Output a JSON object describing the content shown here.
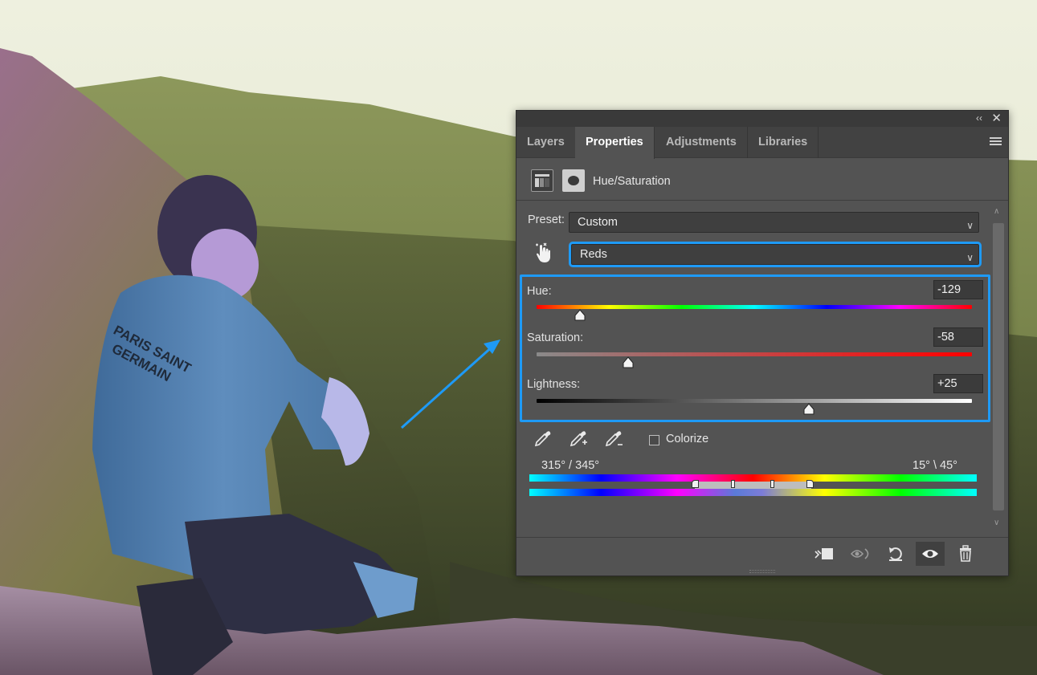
{
  "panel": {
    "tabs": [
      {
        "label": "Layers",
        "active": false
      },
      {
        "label": "Properties",
        "active": true
      },
      {
        "label": "Adjustments",
        "active": false
      },
      {
        "label": "Libraries",
        "active": false
      }
    ],
    "collapse_icon": "double-chevron-left-icon",
    "close_icon": "close-icon",
    "menu_icon": "hamburger-menu-icon",
    "header": {
      "title": "Hue/Saturation",
      "adjustment_icon": "hue-saturation-adjustment-icon",
      "mask_icon": "layer-mask-icon"
    },
    "preset": {
      "label": "Preset:",
      "value": "Custom"
    },
    "channel": {
      "value": "Reds",
      "hand_tool_icon": "targeted-adjustment-hand-icon"
    },
    "sliders": {
      "hue": {
        "label": "Hue:",
        "value": "-129",
        "fraction": 0.1
      },
      "saturation": {
        "label": "Saturation:",
        "value": "-58",
        "fraction": 0.21
      },
      "lightness": {
        "label": "Lightness:",
        "value": "+25",
        "fraction": 0.625
      }
    },
    "tools": {
      "eyedropper_icon": "eyedropper-icon",
      "eyedropper_add_icon": "eyedropper-plus-icon",
      "eyedropper_subtract_icon": "eyedropper-minus-icon",
      "colorize_label": "Colorize",
      "colorize_checked": false
    },
    "range": {
      "left_label": "315° / 345°",
      "right_label": "15° \\ 45°"
    },
    "footer": {
      "clip_icon": "clip-to-layer-icon",
      "view_previous_icon": "view-previous-state-icon",
      "reset_icon": "reset-icon",
      "visibility_icon": "eye-icon",
      "delete_icon": "trash-icon"
    }
  },
  "annotations": {
    "highlight_color": "#1e9af6"
  }
}
